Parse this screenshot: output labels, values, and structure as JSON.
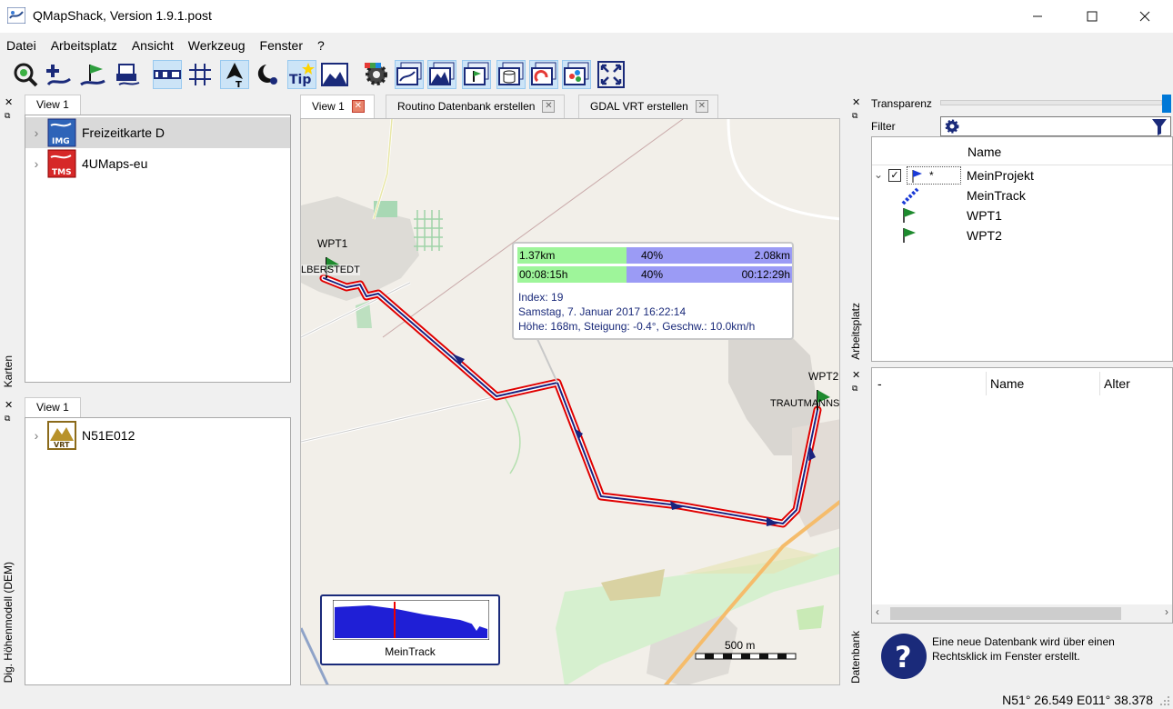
{
  "window": {
    "title": "QMapShack, Version 1.9.1.post"
  },
  "menu": [
    "Datei",
    "Arbeitsplatz",
    "Ansicht",
    "Werkzeug",
    "Fenster",
    "?"
  ],
  "toolbar": {
    "icons": [
      "zoom-search-icon",
      "add-waypoint-icon",
      "route-flag-icon",
      "print-map-icon",
      "ruler-icon",
      "grid-icon",
      "north-arrow-icon",
      "night-mode-icon",
      "tooltip-icon",
      "map-window-icon",
      "settings-gear-icon",
      "map-view-icon",
      "dem-view-icon",
      "gis-view-icon",
      "database-view-icon",
      "rt-view-icon",
      "gis-project-view-icon",
      "fullscreen-icon"
    ],
    "tip_label": "Tip"
  },
  "left_top": {
    "dock_title": "Karten",
    "tab": "View 1",
    "items": [
      {
        "label": "Freizeitkarte D",
        "badge": "IMG",
        "selected": true
      },
      {
        "label": "4UMaps-eu",
        "badge": "TMS",
        "selected": false
      }
    ]
  },
  "left_bottom": {
    "dock_title": "Dig. Höhenmodell (DEM)",
    "tab": "View 1",
    "items": [
      {
        "label": "N51E012",
        "badge": "VRT"
      }
    ]
  },
  "map_tabs": [
    {
      "label": "View 1",
      "active": true
    },
    {
      "label": "Routino Datenbank erstellen",
      "active": false
    },
    {
      "label": "GDAL VRT erstellen",
      "active": false
    }
  ],
  "map": {
    "labels": {
      "wpt1": "WPT1",
      "wpt2": "WPT2",
      "town1": "LBERSTEDT",
      "town2": "TRAUTMANNS"
    },
    "popup": {
      "dist_done": "1.37km",
      "dist_pct": "40%",
      "dist_total": "2.08km",
      "time_done": "00:08:15h",
      "time_pct": "40%",
      "time_total": "00:12:29h",
      "index": "Index: 19",
      "date": "Samstag, 7. Januar 2017 16:22:14",
      "stats": "Höhe: 168m, Steigung: -0.4°, Geschw.: 10.0km/h"
    },
    "profile_label": "MeinTrack",
    "scale_label": "500 m"
  },
  "right_top": {
    "dock_title": "Arbeitsplatz",
    "transparency_label": "Transparenz",
    "filter_label": "Filter",
    "column_name": "Name",
    "items": [
      {
        "label": "MeinProjekt",
        "kind": "project",
        "checked": true,
        "marker": "*"
      },
      {
        "label": "MeinTrack",
        "kind": "track"
      },
      {
        "label": "WPT1",
        "kind": "waypoint"
      },
      {
        "label": "WPT2",
        "kind": "waypoint"
      }
    ]
  },
  "right_bottom": {
    "dock_title": "Datenbank",
    "columns": [
      "-",
      "Name",
      "Alter"
    ],
    "hint": "Eine neue Datenbank wird über einen Rechtsklick im Fenster erstellt."
  },
  "status": {
    "coords": "N51° 26.549 E011° 38.378"
  },
  "colors": {
    "track": "#e00000",
    "track_core": "#1a237e",
    "route_green": "#9ef59a",
    "route_blue": "#9b9bf5",
    "accent": "#0078d7"
  }
}
